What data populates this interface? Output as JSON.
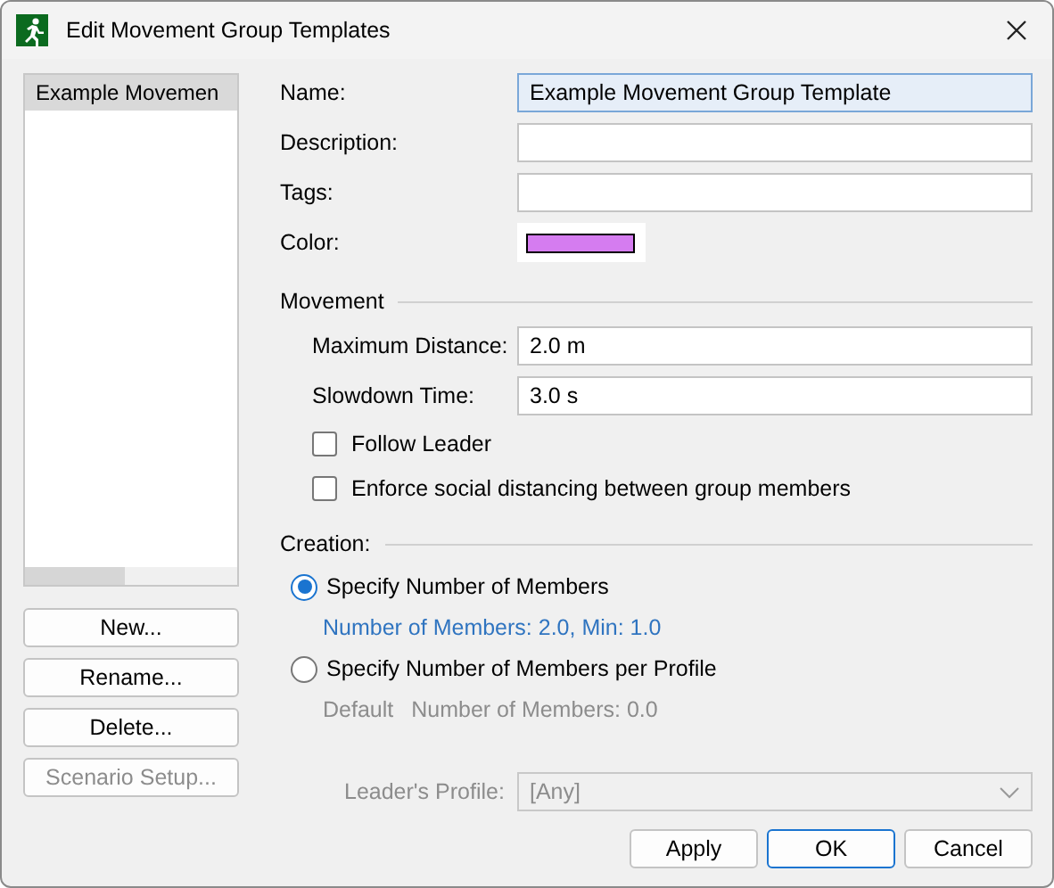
{
  "window": {
    "title": "Edit Movement Group Templates"
  },
  "templates": [
    {
      "label": "Example Movemen",
      "selected": true
    }
  ],
  "list_buttons": [
    {
      "label": "New...",
      "disabled": false
    },
    {
      "label": "Rename...",
      "disabled": false
    },
    {
      "label": "Delete...",
      "disabled": false
    },
    {
      "label": "Scenario Setup...",
      "disabled": true
    }
  ],
  "form": {
    "fields": [
      {
        "label": "Name:",
        "value": "Example Movement Group Template",
        "focused": true
      },
      {
        "label": "Description:",
        "focused": false
      },
      {
        "label": "Tags:",
        "focused": false
      }
    ],
    "color": {
      "label": "Color:",
      "color": "#d57cf0"
    }
  },
  "movement": {
    "title": "Movement",
    "fields": [
      {
        "label": "Maximum Distance:",
        "value": "2.0 m"
      },
      {
        "label": "Slowdown Time:",
        "value": "3.0 s"
      }
    ],
    "checkboxes": [
      {
        "label": "Follow Leader",
        "checked": false
      },
      {
        "label": "Enforce social distancing between group members",
        "checked": false
      }
    ]
  },
  "creation": {
    "title": "Creation:",
    "options": [
      {
        "label": "Specify Number of Members",
        "selected": true,
        "details": [
          "Number of Members: 2.0, Min: 1.0"
        ]
      },
      {
        "label": "Specify Number of Members per Profile",
        "selected": false,
        "details": [
          "Default",
          "Number of Members: 0.0"
        ]
      }
    ]
  },
  "leader_profile": {
    "label": "Leader's Profile:",
    "value": "[Any]",
    "disabled": true
  },
  "buttons": [
    {
      "label": "Apply",
      "default": false
    },
    {
      "label": "OK",
      "default": true
    },
    {
      "label": "Cancel",
      "default": false
    }
  ]
}
